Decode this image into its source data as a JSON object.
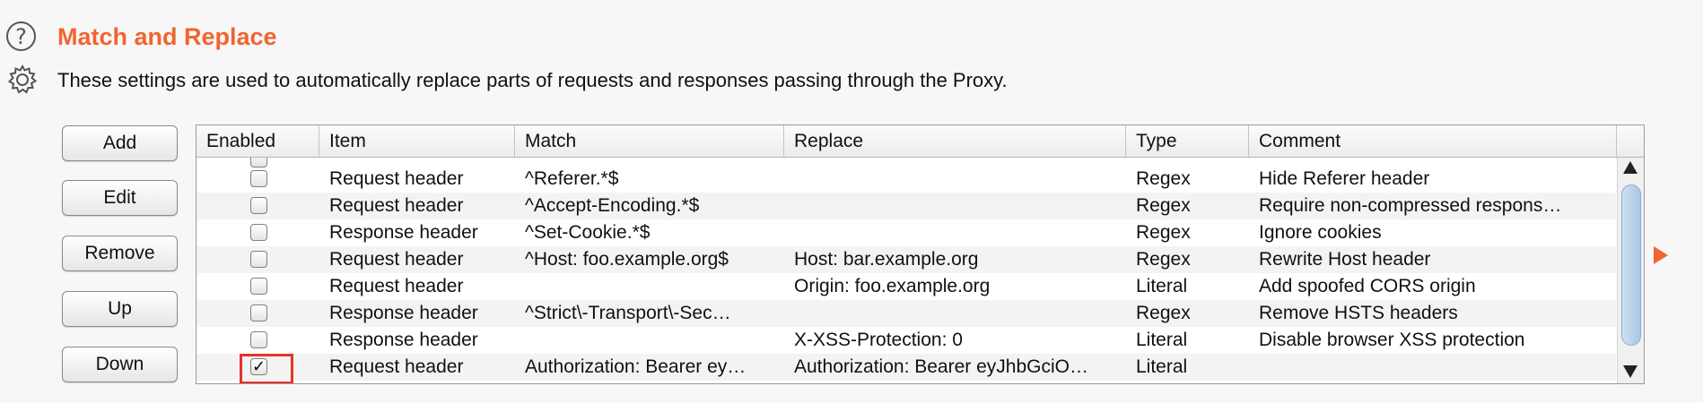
{
  "header": {
    "title": "Match and Replace",
    "description": "These settings are used to automatically replace parts of requests and responses passing through the Proxy.",
    "help_icon": "?"
  },
  "buttons": {
    "add": "Add",
    "edit": "Edit",
    "remove": "Remove",
    "up": "Up",
    "down": "Down"
  },
  "table": {
    "columns": [
      "Enabled",
      "Item",
      "Match",
      "Replace",
      "Type",
      "Comment"
    ],
    "rows": [
      {
        "enabled": false,
        "enabled_mark": "",
        "item": "Request header",
        "match": "^Referer.*$",
        "replace": "",
        "type": "Regex",
        "comment": "Hide Referer header"
      },
      {
        "enabled": false,
        "enabled_mark": "",
        "item": "Request header",
        "match": "^Accept-Encoding.*$",
        "replace": "",
        "type": "Regex",
        "comment": "Require non-compressed respons…"
      },
      {
        "enabled": false,
        "enabled_mark": "",
        "item": "Response header",
        "match": "^Set-Cookie.*$",
        "replace": "",
        "type": "Regex",
        "comment": "Ignore cookies"
      },
      {
        "enabled": false,
        "enabled_mark": "",
        "item": "Request header",
        "match": "^Host: foo.example.org$",
        "replace": "Host: bar.example.org",
        "type": "Regex",
        "comment": "Rewrite Host header"
      },
      {
        "enabled": false,
        "enabled_mark": "",
        "item": "Request header",
        "match": "",
        "replace": "Origin: foo.example.org",
        "type": "Literal",
        "comment": "Add spoofed CORS origin"
      },
      {
        "enabled": false,
        "enabled_mark": "",
        "item": "Response header",
        "match": "^Strict\\-Transport\\-Sec…",
        "replace": "",
        "type": "Regex",
        "comment": "Remove HSTS headers"
      },
      {
        "enabled": false,
        "enabled_mark": "",
        "item": "Response header",
        "match": "",
        "replace": "X-XSS-Protection: 0",
        "type": "Literal",
        "comment": "Disable browser XSS protection"
      },
      {
        "enabled": true,
        "enabled_mark": "✓",
        "item": "Request header",
        "match": "Authorization: Bearer ey…",
        "replace": "Authorization: Bearer eyJhbGciO…",
        "type": "Literal",
        "comment": ""
      }
    ]
  },
  "colors": {
    "accent": "#f06530",
    "highlight": "#e8322a"
  }
}
